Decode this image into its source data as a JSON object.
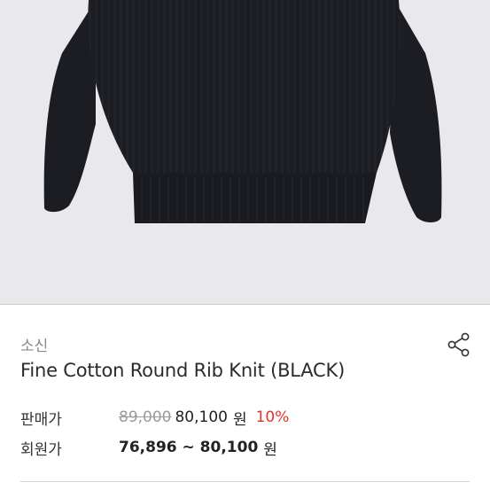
{
  "product": {
    "brand": "소신",
    "title": "Fine Cotton Round Rib Knit (BLACK)",
    "image_alt": "black knit sweater",
    "share_icon": "share-icon"
  },
  "price": {
    "label": "판매가",
    "original": "89,000",
    "sale": "80,100",
    "currency": "원",
    "discount": "10%"
  },
  "member_price": {
    "label": "회원가",
    "range": "76,896 ~ 80,100",
    "currency": "원"
  },
  "colors": {
    "discount": "#e0352b",
    "photo_bg": "#e9e9eb",
    "sweater": "#1c1d22"
  }
}
